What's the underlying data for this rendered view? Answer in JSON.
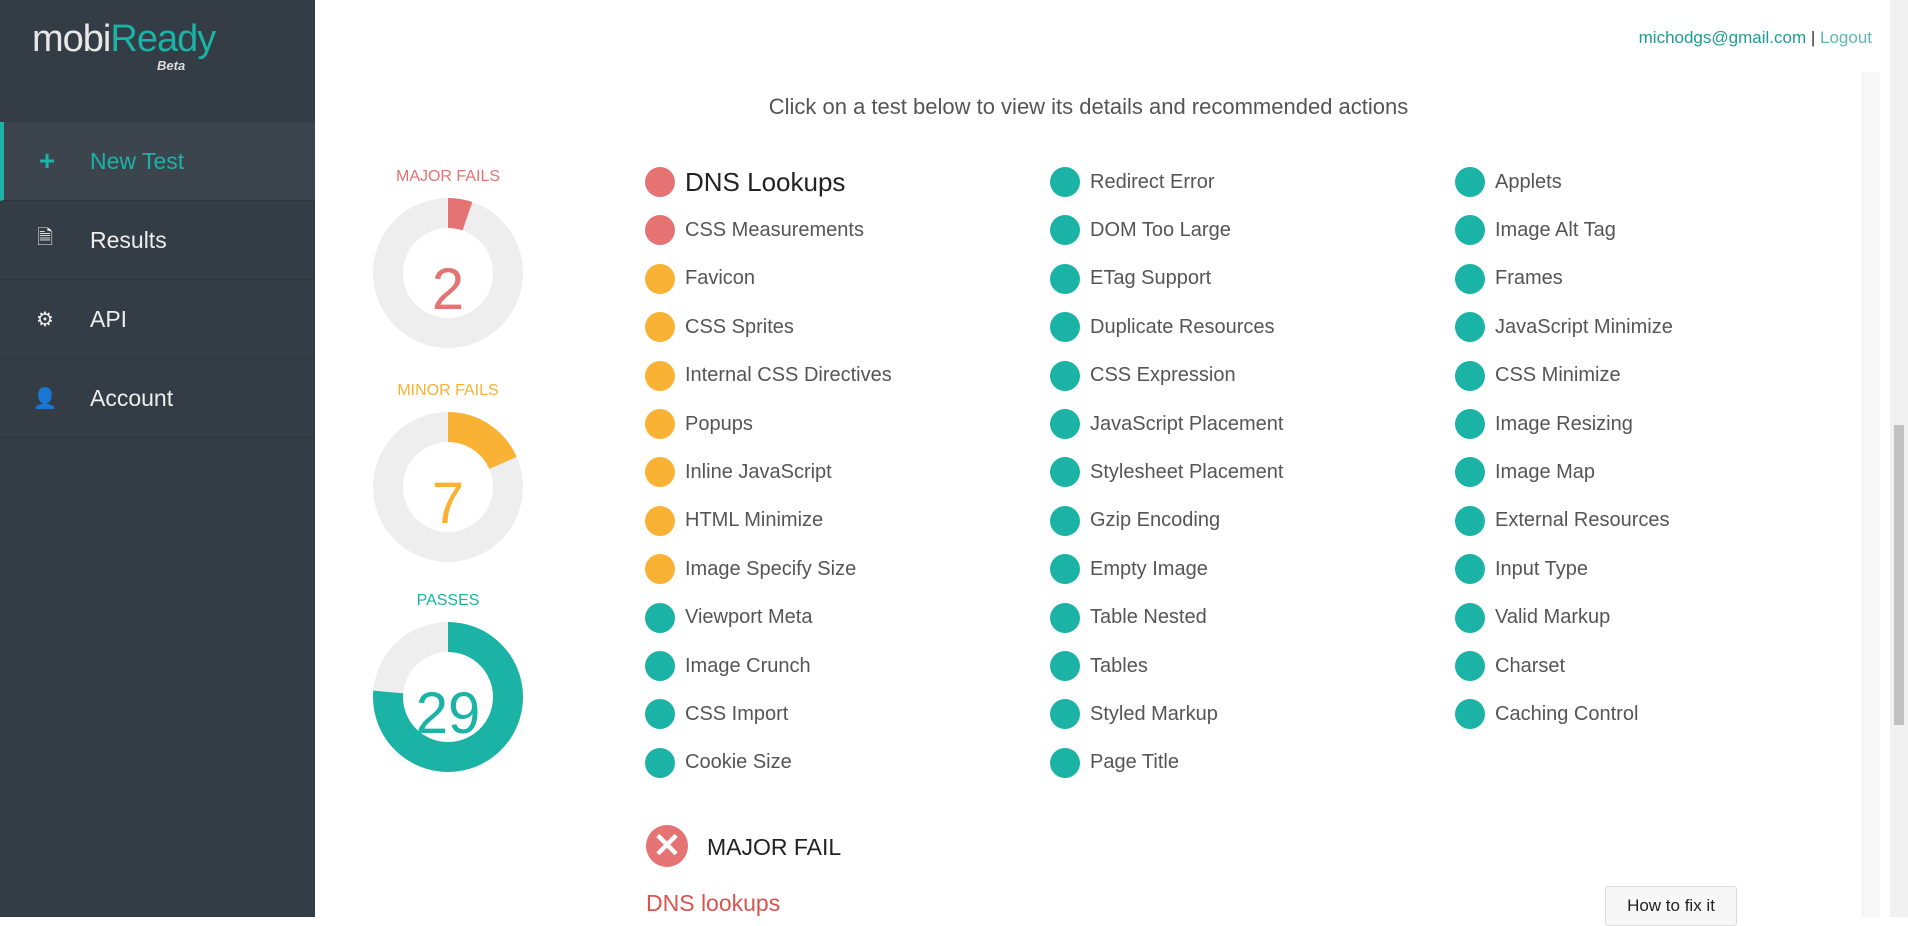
{
  "brand": {
    "name_a": "mobi",
    "name_b": "Ready",
    "badge": "Beta"
  },
  "sidebar": {
    "items": [
      {
        "label": "New Test",
        "icon": "plus-icon",
        "glyph": "+",
        "active": true
      },
      {
        "label": "Results",
        "icon": "document-icon",
        "glyph": "🗎"
      },
      {
        "label": "API",
        "icon": "gears-icon",
        "glyph": "⚙"
      },
      {
        "label": "Account",
        "icon": "user-icon",
        "glyph": "👤"
      }
    ]
  },
  "header": {
    "email": "michodgs@gmail.com",
    "separator": "|",
    "logout": "Logout"
  },
  "intro": "Click on a test below to view its details and recommended actions",
  "colors": {
    "major": "#e57373",
    "minor": "#f9b233",
    "pass": "#1ab3a6",
    "track": "#eeeeee"
  },
  "summary": [
    {
      "label": "MAJOR FAILS",
      "count": "2",
      "value": 2,
      "total": 38,
      "status": "major"
    },
    {
      "label": "MINOR FAILS",
      "count": "7",
      "value": 7,
      "total": 38,
      "status": "minor"
    },
    {
      "label": "PASSES",
      "count": "29",
      "value": 29,
      "total": 38,
      "status": "pass"
    }
  ],
  "tests": [
    [
      {
        "name": "DNS Lookups",
        "status": "major",
        "selected": true
      },
      {
        "name": "CSS Measurements",
        "status": "major"
      },
      {
        "name": "Favicon",
        "status": "minor"
      },
      {
        "name": "CSS Sprites",
        "status": "minor"
      },
      {
        "name": "Internal CSS Directives",
        "status": "minor"
      },
      {
        "name": "Popups",
        "status": "minor"
      },
      {
        "name": "Inline JavaScript",
        "status": "minor"
      },
      {
        "name": "HTML Minimize",
        "status": "minor"
      },
      {
        "name": "Image Specify Size",
        "status": "minor"
      },
      {
        "name": "Viewport Meta",
        "status": "pass"
      },
      {
        "name": "Image Crunch",
        "status": "pass"
      },
      {
        "name": "CSS Import",
        "status": "pass"
      },
      {
        "name": "Cookie Size",
        "status": "pass"
      }
    ],
    [
      {
        "name": "Redirect Error",
        "status": "pass"
      },
      {
        "name": "DOM Too Large",
        "status": "pass"
      },
      {
        "name": "ETag Support",
        "status": "pass"
      },
      {
        "name": "Duplicate Resources",
        "status": "pass"
      },
      {
        "name": "CSS Expression",
        "status": "pass"
      },
      {
        "name": "JavaScript Placement",
        "status": "pass"
      },
      {
        "name": "Stylesheet Placement",
        "status": "pass"
      },
      {
        "name": "Gzip Encoding",
        "status": "pass"
      },
      {
        "name": "Empty Image",
        "status": "pass"
      },
      {
        "name": "Table Nested",
        "status": "pass"
      },
      {
        "name": "Tables",
        "status": "pass"
      },
      {
        "name": "Styled Markup",
        "status": "pass"
      },
      {
        "name": "Page Title",
        "status": "pass"
      }
    ],
    [
      {
        "name": "Applets",
        "status": "pass"
      },
      {
        "name": "Image Alt Tag",
        "status": "pass"
      },
      {
        "name": "Frames",
        "status": "pass"
      },
      {
        "name": "JavaScript Minimize",
        "status": "pass"
      },
      {
        "name": "CSS Minimize",
        "status": "pass"
      },
      {
        "name": "Image Resizing",
        "status": "pass"
      },
      {
        "name": "Image Map",
        "status": "pass"
      },
      {
        "name": "External Resources",
        "status": "pass"
      },
      {
        "name": "Input Type",
        "status": "pass"
      },
      {
        "name": "Valid Markup",
        "status": "pass"
      },
      {
        "name": "Charset",
        "status": "pass"
      },
      {
        "name": "Caching Control",
        "status": "pass"
      }
    ]
  ],
  "detail": {
    "status_icon": "x-circle-icon",
    "status_glyph": "✕",
    "status_label": "MAJOR FAIL",
    "title": "DNS lookups",
    "fix_button": "How to fix it"
  }
}
